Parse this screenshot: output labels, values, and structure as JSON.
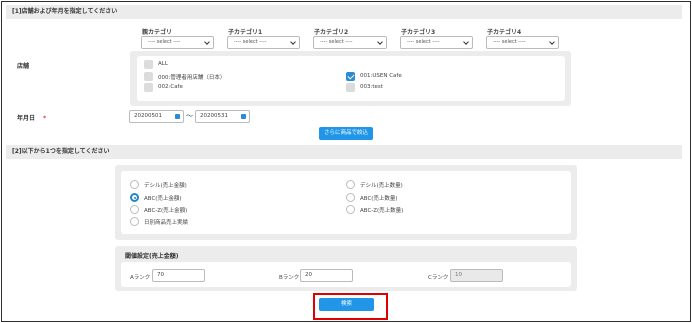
{
  "section1": {
    "title": "[1]店舗および年月を指定してください",
    "categories": [
      {
        "label": "親カテゴリ",
        "value": "---- select ----"
      },
      {
        "label": "子カテゴリ1",
        "value": "---- select ----"
      },
      {
        "label": "子カテゴリ2",
        "value": "---- select ----"
      },
      {
        "label": "子カテゴリ3",
        "value": "---- select ----"
      },
      {
        "label": "子カテゴリ4",
        "value": "---- select ----"
      }
    ],
    "store_label": "店舗",
    "stores": [
      {
        "label": "ALL",
        "checked": false
      },
      {
        "label": "000:管理者用店舗（日本）",
        "checked": false
      },
      {
        "label": "001:USEN Cafe",
        "checked": true
      },
      {
        "label": "002:Cafe",
        "checked": false
      },
      {
        "label": "003:test",
        "checked": false
      }
    ],
    "date_label": "年月日",
    "required_mark": "*",
    "date_from": "20200501",
    "date_to": "20200531",
    "tilde": "～",
    "filter_button": "さらに商品で絞込"
  },
  "section2": {
    "title": "[2]以下から1つを指定してください",
    "options": [
      {
        "label": "デシル(売上金額)",
        "selected": false
      },
      {
        "label": "デシル(売上数量)",
        "selected": false
      },
      {
        "label": "ABC(売上金額)",
        "selected": true
      },
      {
        "label": "ABC(売上数量)",
        "selected": false
      },
      {
        "label": "ABC-Z(売上金額)",
        "selected": false
      },
      {
        "label": "ABC-Z(売上数量)",
        "selected": false
      },
      {
        "label": "日別商品売上実績",
        "selected": false
      }
    ],
    "threshold_title": "閾値設定(売上金額)",
    "ranks": [
      {
        "label": "Aランク",
        "value": "70"
      },
      {
        "label": "Bランク",
        "value": "20"
      },
      {
        "label": "Cランク",
        "value": "10"
      }
    ],
    "search_button": "検索"
  },
  "colors": {
    "accent": "#2196e8",
    "highlight": "#e00000",
    "required": "#e63946"
  }
}
